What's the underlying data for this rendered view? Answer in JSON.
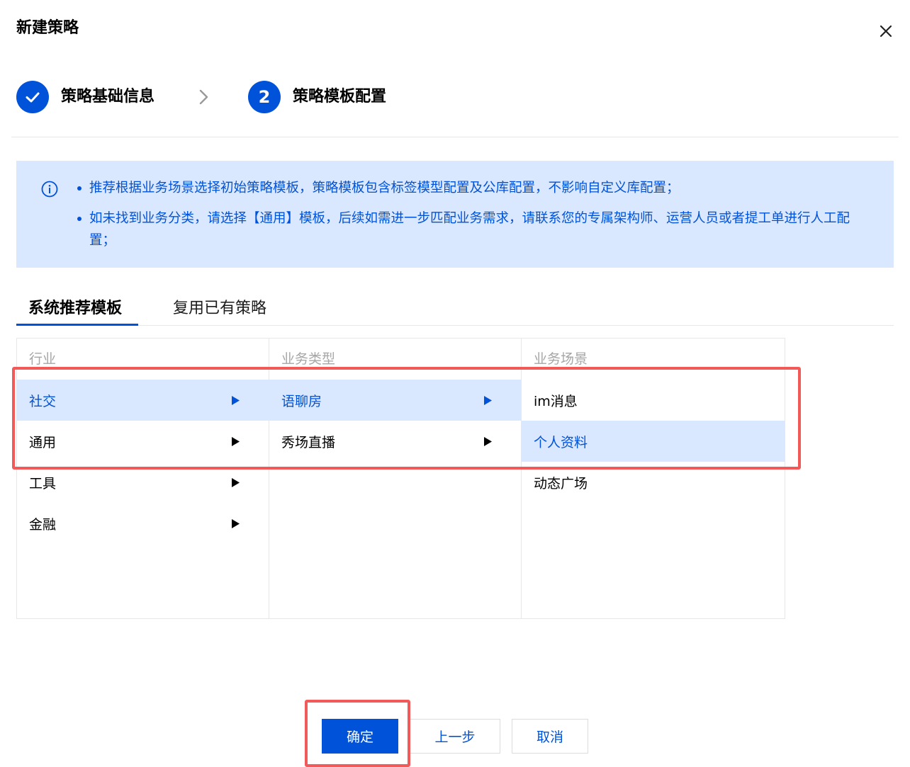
{
  "dialog": {
    "title": "新建策略"
  },
  "steps": [
    {
      "label": "策略基础信息",
      "status": "done"
    },
    {
      "number": "2",
      "label": "策略模板配置",
      "status": "active"
    }
  ],
  "info": {
    "items": [
      "推荐根据业务场景选择初始策略模板，策略模板包含标签模型配置及公库配置，不影响自定义库配置；",
      "如未找到业务分类，请选择【通用】模板，后续如需进一步匹配业务需求，请联系您的专属架构师、运营人员或者提工单进行人工配置；"
    ]
  },
  "tabs": [
    {
      "label": "系统推荐模板",
      "active": true
    },
    {
      "label": "复用已有策略",
      "active": false
    }
  ],
  "cascader": {
    "industry": {
      "header": "行业",
      "items": [
        "社交",
        "通用",
        "工具",
        "金融"
      ],
      "selected": "社交"
    },
    "business_type": {
      "header": "业务类型",
      "items": [
        "语聊房",
        "秀场直播"
      ],
      "selected": "语聊房"
    },
    "scene": {
      "header": "业务场景",
      "items": [
        "im消息",
        "个人资料",
        "动态广场"
      ],
      "selected": "个人资料"
    }
  },
  "footer": {
    "confirm_label": "确定",
    "prev_label": "上一步",
    "cancel_label": "取消"
  },
  "colors": {
    "primary": "#0052d9",
    "selected_bg": "#d9e8ff",
    "info_bg": "#d9e8ff",
    "highlight": "#f25a5a",
    "muted_text": "#a6a6a6",
    "border": "#e7e7e7"
  },
  "icons": {
    "close": "close-icon",
    "step_done": "check-icon",
    "step_separator": "chevron-right-icon",
    "info": "info-circle-icon",
    "expand": "caret-right-icon"
  }
}
